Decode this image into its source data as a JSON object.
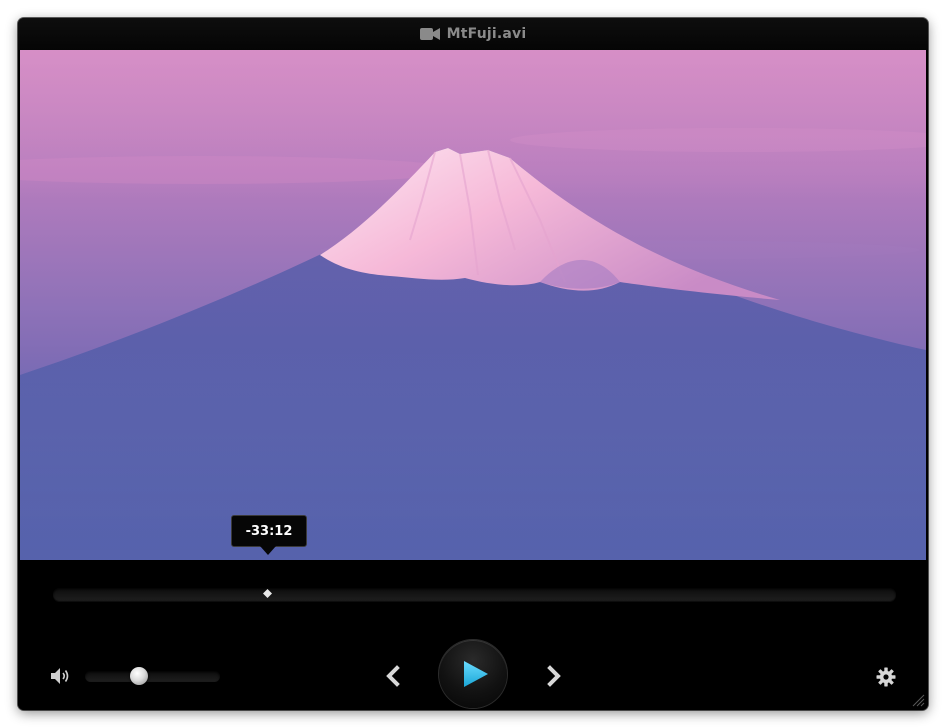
{
  "window": {
    "title": "MtFuji.avi",
    "title_icon": "video-camera-icon"
  },
  "video": {
    "content": "mountain-landscape"
  },
  "seek": {
    "tooltip_time": "-33:12",
    "progress_fraction": 0.255
  },
  "volume": {
    "icon": "speaker-icon",
    "level_fraction": 0.4
  },
  "controls": {
    "prev_icon": "chevron-left-icon",
    "play_icon": "play-icon",
    "next_icon": "chevron-right-icon",
    "settings_icon": "gear-icon"
  },
  "colors": {
    "accent": "#3ec6ee",
    "background": "#000000",
    "title_text": "#8a8a8a"
  }
}
